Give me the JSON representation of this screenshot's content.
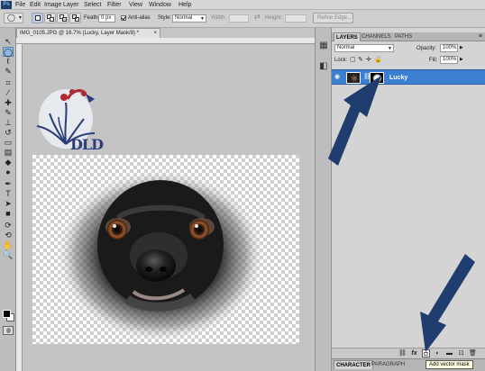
{
  "menubar": {
    "app_logo": "Ps",
    "items": [
      "File",
      "Edit",
      "Image",
      "Layer",
      "Select",
      "Filter",
      "View",
      "Window",
      "Help"
    ]
  },
  "options": {
    "feather_label": "Feather:",
    "feather_value": "0 px",
    "antialias_label": "Anti-alias",
    "antialias_checked": true,
    "style_label": "Style:",
    "style_value": "Normal",
    "width_label": "Width:",
    "height_label": "Height:",
    "refine_edge_label": "Refine Edge..."
  },
  "document": {
    "tab_title": "IMG_0105.JPG @ 16.7% (Lucky, Layer Mask/8) *",
    "close_glyph": "×",
    "logo_text": "DLD"
  },
  "tools": [
    {
      "name": "move-tool-icon",
      "glyph": "↖"
    },
    {
      "name": "elliptical-marquee-tool-icon",
      "glyph": "◯"
    },
    {
      "name": "lasso-tool-icon",
      "glyph": "ℓ"
    },
    {
      "name": "quick-selection-tool-icon",
      "glyph": "✎"
    },
    {
      "name": "crop-tool-icon",
      "glyph": "⌗"
    },
    {
      "name": "eyedropper-tool-icon",
      "glyph": "⁄"
    },
    {
      "name": "healing-brush-tool-icon",
      "glyph": "✚"
    },
    {
      "name": "brush-tool-icon",
      "glyph": "✎"
    },
    {
      "name": "clone-stamp-tool-icon",
      "glyph": "⊥"
    },
    {
      "name": "history-brush-tool-icon",
      "glyph": "↺"
    },
    {
      "name": "eraser-tool-icon",
      "glyph": "▭"
    },
    {
      "name": "gradient-tool-icon",
      "glyph": "▤"
    },
    {
      "name": "blur-tool-icon",
      "glyph": "◆"
    },
    {
      "name": "dodge-tool-icon",
      "glyph": "●"
    },
    {
      "name": "pen-tool-icon",
      "glyph": "✒"
    },
    {
      "name": "type-tool-icon",
      "glyph": "T"
    },
    {
      "name": "path-selection-tool-icon",
      "glyph": "➤"
    },
    {
      "name": "shape-tool-icon",
      "glyph": "■"
    },
    {
      "name": "3d-rotate-tool-icon",
      "glyph": "⟳"
    },
    {
      "name": "3d-camera-tool-icon",
      "glyph": "⟲"
    },
    {
      "name": "hand-tool-icon",
      "glyph": "✋"
    },
    {
      "name": "zoom-tool-icon",
      "glyph": "🔍"
    }
  ],
  "layers_panel": {
    "tabs": [
      "LAYERS",
      "CHANNELS",
      "PATHS"
    ],
    "menu_glyph": "≡",
    "blend_mode": "Normal",
    "opacity_label": "Opacity:",
    "opacity_value": "100%",
    "lock_label": "Lock:",
    "fill_label": "Fill:",
    "fill_value": "100%",
    "layer_name": "Lucky",
    "bottom_icons": [
      "link-layers-icon",
      "fx-icon",
      "add-vector-mask-icon",
      "adjustment-layer-icon",
      "group-icon",
      "new-layer-icon",
      "delete-layer-icon"
    ],
    "tooltip": "Add vector mask"
  },
  "bottom_tabs": [
    "CHARACTER",
    "PARAGRAPH"
  ],
  "colors": {
    "accent": "#3a7fd0",
    "arrow": "#1f3d6e",
    "logo_red": "#b02a32",
    "logo_blue": "#2a3d7a"
  }
}
